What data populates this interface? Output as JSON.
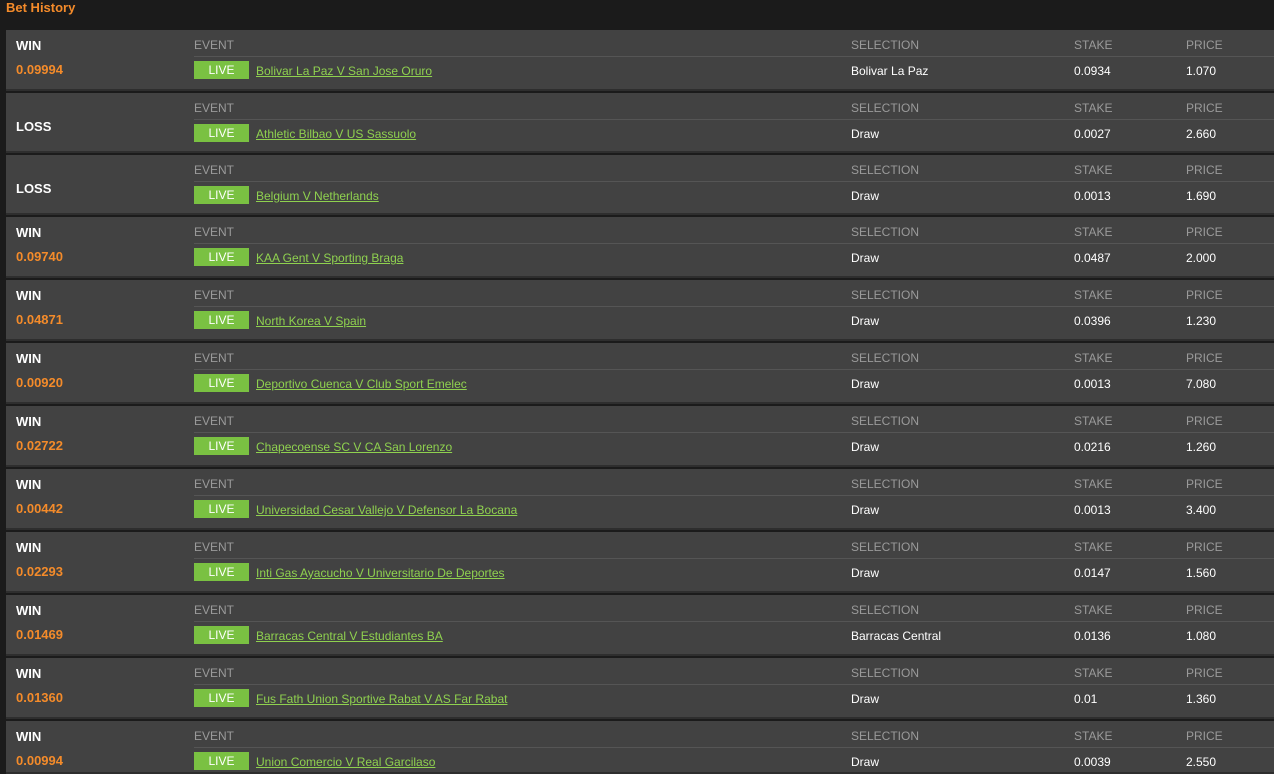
{
  "header": {
    "title": "Bet History"
  },
  "columns": {
    "event": "EVENT",
    "selection": "SELECTION",
    "stake": "STAKE",
    "price": "PRICE"
  },
  "live_label": "LIVE",
  "colors": {
    "accent_orange": "#f48b2a",
    "live_green": "#7ac142",
    "link_green": "#8fd14f",
    "row_bg": "#424242"
  },
  "bets": [
    {
      "result": "WIN",
      "payout": "0.09994",
      "event": "Bolivar La Paz V San Jose Oruro",
      "selection": "Bolivar La Paz",
      "stake": "0.0934",
      "price": "1.070"
    },
    {
      "result": "LOSS",
      "payout": "",
      "event": "Athletic Bilbao V US Sassuolo",
      "selection": "Draw",
      "stake": "0.0027",
      "price": "2.660"
    },
    {
      "result": "LOSS",
      "payout": "",
      "event": "Belgium V Netherlands",
      "selection": "Draw",
      "stake": "0.0013",
      "price": "1.690"
    },
    {
      "result": "WIN",
      "payout": "0.09740",
      "event": "KAA Gent V Sporting Braga",
      "selection": "Draw",
      "stake": "0.0487",
      "price": "2.000"
    },
    {
      "result": "WIN",
      "payout": "0.04871",
      "event": "North Korea V Spain",
      "selection": "Draw",
      "stake": "0.0396",
      "price": "1.230"
    },
    {
      "result": "WIN",
      "payout": "0.00920",
      "event": "Deportivo Cuenca V Club Sport Emelec",
      "selection": "Draw",
      "stake": "0.0013",
      "price": "7.080"
    },
    {
      "result": "WIN",
      "payout": "0.02722",
      "event": "Chapecoense SC V CA San Lorenzo",
      "selection": "Draw",
      "stake": "0.0216",
      "price": "1.260"
    },
    {
      "result": "WIN",
      "payout": "0.00442",
      "event": "Universidad Cesar Vallejo V Defensor La Bocana",
      "selection": "Draw",
      "stake": "0.0013",
      "price": "3.400"
    },
    {
      "result": "WIN",
      "payout": "0.02293",
      "event": "Inti Gas Ayacucho V Universitario De Deportes",
      "selection": "Draw",
      "stake": "0.0147",
      "price": "1.560"
    },
    {
      "result": "WIN",
      "payout": "0.01469",
      "event": "Barracas Central V Estudiantes BA",
      "selection": "Barracas Central",
      "stake": "0.0136",
      "price": "1.080"
    },
    {
      "result": "WIN",
      "payout": "0.01360",
      "event": "Fus Fath Union Sportive Rabat V AS Far Rabat",
      "selection": "Draw",
      "stake": "0.01",
      "price": "1.360"
    },
    {
      "result": "WIN",
      "payout": "0.00994",
      "event": "Union Comercio V Real Garcilaso",
      "selection": "Draw",
      "stake": "0.0039",
      "price": "2.550"
    }
  ]
}
